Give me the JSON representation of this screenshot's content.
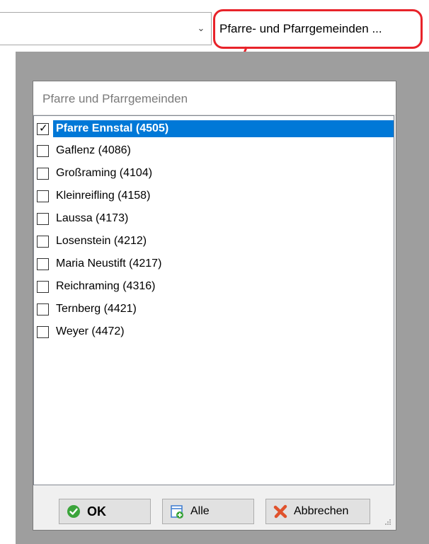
{
  "combo": {
    "value": ""
  },
  "filter_button": {
    "label": "Pfarre- und Pfarrgemeinden ..."
  },
  "dialog": {
    "title": "Pfarre und Pfarrgemeinden",
    "items": [
      {
        "label": "Pfarre Ennstal (4505)",
        "checked": true,
        "selected": true
      },
      {
        "label": "Gaflenz (4086)",
        "checked": false
      },
      {
        "label": "Großraming (4104)",
        "checked": false
      },
      {
        "label": "Kleinreifling (4158)",
        "checked": false
      },
      {
        "label": "Laussa (4173)",
        "checked": false
      },
      {
        "label": "Losenstein (4212)",
        "checked": false
      },
      {
        "label": "Maria Neustift (4217)",
        "checked": false
      },
      {
        "label": "Reichraming (4316)",
        "checked": false
      },
      {
        "label": "Ternberg (4421)",
        "checked": false
      },
      {
        "label": "Weyer (4472)",
        "checked": false
      }
    ],
    "buttons": {
      "ok": "OK",
      "all": "Alle",
      "cancel": "Abbrechen"
    }
  },
  "colors": {
    "highlight": "#e8232a",
    "selection": "#0078d7",
    "ok_icon": "#3aa43a",
    "cancel_icon": "#e0522c"
  },
  "icons": {
    "ok": "check-circle-icon",
    "all": "add-document-icon",
    "cancel": "x-icon",
    "dropdown": "chevron-down-icon"
  }
}
